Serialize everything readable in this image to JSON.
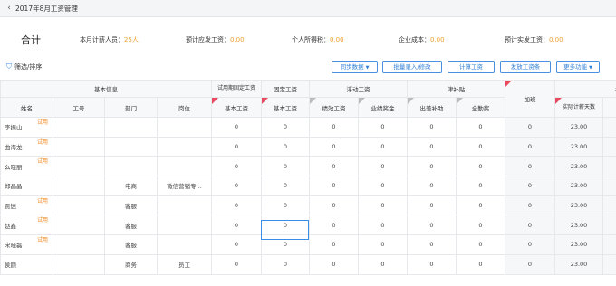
{
  "app": {
    "title": "2017年8月工资管理"
  },
  "summary": {
    "total_label": "合计",
    "items": [
      {
        "label": "本月计薪人员：",
        "value": "25人"
      },
      {
        "label": "预计应发工资：",
        "value": "0.00"
      },
      {
        "label": "个人所得税：",
        "value": "0.00"
      },
      {
        "label": "企业成本：",
        "value": "0.00"
      },
      {
        "label": "预计实发工资：",
        "value": "0.00"
      }
    ]
  },
  "toolbar": {
    "filter_label": "筛选/排序",
    "buttons": [
      "同步数据",
      "批量录入/修改",
      "计算工资",
      "发放工资条",
      "更多功能"
    ]
  },
  "table": {
    "group_headers": [
      "基本信息",
      "试用期固定工资",
      "固定工资",
      "浮动工资",
      "津补贴",
      "加班",
      "考勤"
    ],
    "columns": [
      "姓名",
      "工号",
      "部门",
      "岗位",
      "基本工资",
      "基本工资",
      "绩效工资",
      "业绩奖金",
      "出差补助",
      "全勤奖",
      "实际计薪天数"
    ],
    "trial_badge": "试用",
    "rows": [
      {
        "name": "李振山",
        "trial": true,
        "dept": "",
        "post": "",
        "vals": [
          "0",
          "0",
          "0",
          "0",
          "0",
          "0",
          "0",
          "23.00"
        ]
      },
      {
        "name": "曲海龙",
        "trial": true,
        "dept": "",
        "post": "",
        "vals": [
          "0",
          "0",
          "0",
          "0",
          "0",
          "0",
          "0",
          "23.00"
        ]
      },
      {
        "name": "么晓丽",
        "trial": true,
        "dept": "",
        "post": "",
        "vals": [
          "0",
          "0",
          "0",
          "0",
          "0",
          "0",
          "0",
          "23.00"
        ]
      },
      {
        "name": "郑晶晶",
        "trial": false,
        "dept": "电商",
        "post": "微信营销专...",
        "vals": [
          "0",
          "0",
          "0",
          "0",
          "0",
          "0",
          "0",
          "23.00"
        ]
      },
      {
        "name": "贾迷",
        "trial": true,
        "dept": "客服",
        "post": "",
        "vals": [
          "0",
          "0",
          "0",
          "0",
          "0",
          "0",
          "0",
          "23.00"
        ]
      },
      {
        "name": "赵鑫",
        "trial": true,
        "dept": "客服",
        "post": "",
        "vals": [
          "0",
          "0",
          "0",
          "0",
          "0",
          "0",
          "0",
          "23.00"
        ]
      },
      {
        "name": "宋晓磊",
        "trial": true,
        "dept": "客服",
        "post": "",
        "vals": [
          "0",
          "0",
          "0",
          "0",
          "0",
          "0",
          "0",
          "23.00"
        ]
      },
      {
        "name": "侯颜",
        "trial": false,
        "dept": "商务",
        "post": "员工",
        "vals": [
          "0",
          "0",
          "0",
          "0",
          "0",
          "0",
          "0",
          "23.00"
        ]
      }
    ]
  },
  "colors": {
    "accent": "#4a90e2",
    "badge": "#f08a24",
    "marker": "#e84a5f"
  }
}
